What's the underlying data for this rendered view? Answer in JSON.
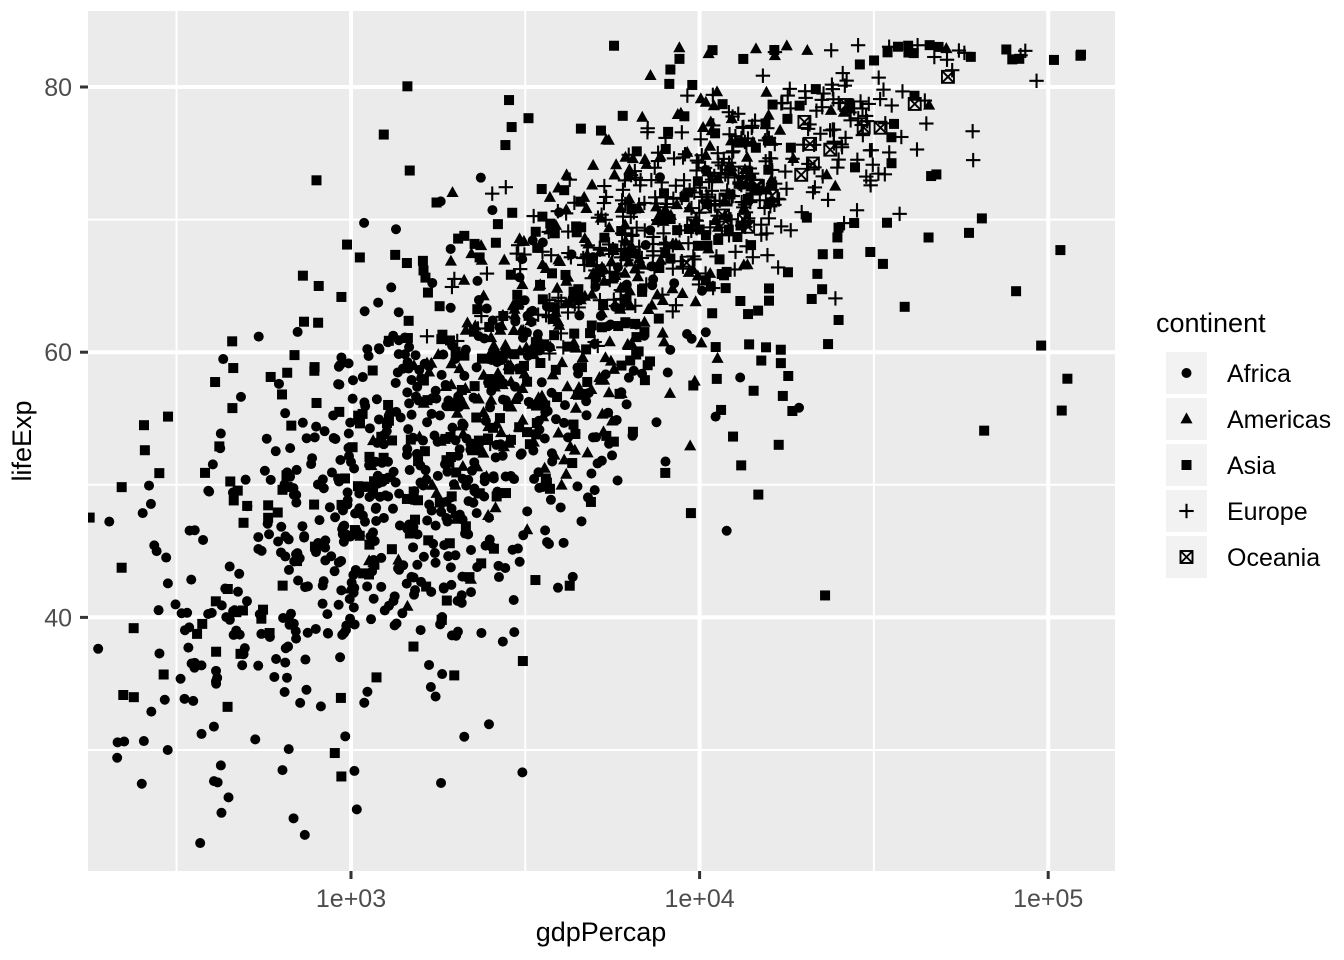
{
  "chart_data": {
    "type": "scatter",
    "title": "",
    "xlabel": "gdpPercap",
    "ylabel": "lifeExp",
    "x_scale": "log10",
    "y_scale": "linear",
    "xlim": [
      241,
      137000
    ],
    "ylim": [
      21.5,
      83.5
    ],
    "x_ticks": [
      1000,
      10000,
      100000
    ],
    "x_tick_labels": [
      "1e+03",
      "1e+04",
      "1e+05"
    ],
    "y_ticks": [
      40,
      60,
      80
    ],
    "y_tick_labels": [
      "40",
      "60",
      "80"
    ],
    "x_minor_ticks": [
      3162,
      31623,
      316
    ],
    "y_minor_ticks": [
      30,
      50,
      70
    ],
    "grid": true,
    "legend_position": "right",
    "legend_title": "continent",
    "panel_background": "#EBEBEB",
    "grid_color": "#FFFFFF",
    "point_color": "#000000",
    "series": [
      {
        "name": "Africa",
        "shape": "circle",
        "n": 624,
        "x_log_mean": 3.12,
        "x_log_sd": 0.36,
        "y_mean": 48.9,
        "y_sd": 9.1,
        "corr": 0.62
      },
      {
        "name": "Americas",
        "shape": "triangle",
        "n": 300,
        "x_log_mean": 3.7,
        "x_log_sd": 0.31,
        "y_mean": 64.7,
        "y_sd": 9.3,
        "corr": 0.73
      },
      {
        "name": "Asia",
        "shape": "square",
        "n": 396,
        "x_log_mean": 3.52,
        "x_log_sd": 0.55,
        "y_mean": 60.1,
        "y_sd": 11.9,
        "corr": 0.69
      },
      {
        "name": "Europe",
        "shape": "plus",
        "n": 360,
        "x_log_mean": 4.04,
        "x_log_sd": 0.33,
        "y_mean": 71.9,
        "y_sd": 5.4,
        "corr": 0.77
      },
      {
        "name": "Oceania",
        "shape": "crossed-square",
        "n": 24,
        "x_log_mean": 4.25,
        "x_log_sd": 0.22,
        "y_mean": 74.3,
        "y_sd": 3.8,
        "corr": 0.95
      }
    ]
  },
  "legend": {
    "title": "continent",
    "entries": [
      {
        "label": "Africa",
        "shape": "circle"
      },
      {
        "label": "Americas",
        "shape": "triangle"
      },
      {
        "label": "Asia",
        "shape": "square"
      },
      {
        "label": "Europe",
        "shape": "plus"
      },
      {
        "label": "Oceania",
        "shape": "crossed-square"
      }
    ]
  },
  "axes": {
    "x_title": "gdpPercap",
    "y_title": "lifeExp",
    "x_tick_labels": [
      "1e+03",
      "1e+04",
      "1e+05"
    ],
    "y_tick_labels": [
      "80",
      "60",
      "40"
    ]
  },
  "colors": {
    "panel": "#EBEBEB",
    "grid": "#FFFFFF",
    "point": "#000000",
    "tick_text": "#4d4d4d",
    "title_text": "#000000",
    "legend_key": "#F2F2F2",
    "page": "#FFFFFF"
  }
}
